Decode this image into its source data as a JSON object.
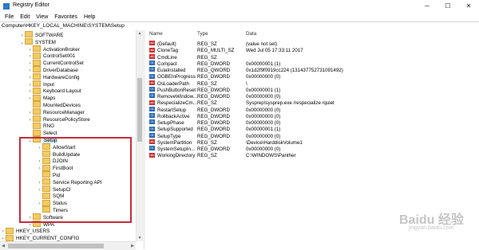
{
  "window": {
    "title": "Registry Editor",
    "min_label": "─",
    "max_label": "☐",
    "close_label": "✕"
  },
  "menu": [
    "File",
    "Edit",
    "View",
    "Favorites",
    "Help"
  ],
  "address": "Computer\\HKEY_LOCAL_MACHINE\\SYSTEM\\Setup",
  "tree": [
    {
      "label": "SOFTWARE",
      "level": 2,
      "expander": "›",
      "selected": false
    },
    {
      "label": "SYSTEM",
      "level": 2,
      "expander": "⌄",
      "selected": false
    },
    {
      "label": "ActivationBroker",
      "level": 3,
      "expander": "›",
      "selected": false
    },
    {
      "label": "ControlSet001",
      "level": 3,
      "expander": "›",
      "selected": false
    },
    {
      "label": "CurrentControlSet",
      "level": 3,
      "expander": "›",
      "selected": false
    },
    {
      "label": "DriverDatabase",
      "level": 3,
      "expander": "›",
      "selected": false
    },
    {
      "label": "HardwareConfig",
      "level": 3,
      "expander": "›",
      "selected": false
    },
    {
      "label": "Input",
      "level": 3,
      "expander": "›",
      "selected": false
    },
    {
      "label": "Keyboard Layout",
      "level": 3,
      "expander": "›",
      "selected": false
    },
    {
      "label": "Maps",
      "level": 3,
      "expander": "›",
      "selected": false
    },
    {
      "label": "MountedDevices",
      "level": 3,
      "expander": "",
      "selected": false
    },
    {
      "label": "ResourceManager",
      "level": 3,
      "expander": "›",
      "selected": false
    },
    {
      "label": "ResourcePolicyStore",
      "level": 3,
      "expander": "›",
      "selected": false
    },
    {
      "label": "RNG",
      "level": 3,
      "expander": "",
      "selected": false
    },
    {
      "label": "Select",
      "level": 3,
      "expander": "",
      "selected": false
    },
    {
      "label": "Setup",
      "level": 3,
      "expander": "⌄",
      "selected": true
    },
    {
      "label": "AllowStart",
      "level": 4,
      "expander": "›",
      "selected": false
    },
    {
      "label": "BuildUpdate",
      "level": 4,
      "expander": "",
      "selected": false
    },
    {
      "label": "DJOIN",
      "level": 4,
      "expander": "›",
      "selected": false
    },
    {
      "label": "FirstBoot",
      "level": 4,
      "expander": "›",
      "selected": false
    },
    {
      "label": "Pid",
      "level": 4,
      "expander": "",
      "selected": false
    },
    {
      "label": "Service Reporting API",
      "level": 4,
      "expander": "›",
      "selected": false
    },
    {
      "label": "SetupCl",
      "level": 4,
      "expander": "›",
      "selected": false
    },
    {
      "label": "SQM",
      "level": 4,
      "expander": "",
      "selected": false
    },
    {
      "label": "Status",
      "level": 4,
      "expander": "›",
      "selected": false
    },
    {
      "label": "Timers",
      "level": 4,
      "expander": "",
      "selected": false
    },
    {
      "label": "Software",
      "level": 3,
      "expander": "›",
      "selected": false
    },
    {
      "label": "WPA",
      "level": 3,
      "expander": "›",
      "selected": false
    },
    {
      "label": "HKEY_USERS",
      "level": 1,
      "expander": "›",
      "selected": false
    },
    {
      "label": "HKEY_CURRENT_CONFIG",
      "level": 1,
      "expander": "›",
      "selected": false
    }
  ],
  "columns": {
    "name": "Name",
    "type": "Type",
    "data": "Data"
  },
  "values": [
    {
      "icon": "sz",
      "name": "(Default)",
      "type": "REG_SZ",
      "data": "(value not set)"
    },
    {
      "icon": "sz",
      "name": "CloneTag",
      "type": "REG_MULTI_SZ",
      "data": "Wed Jul 05 17:33:11 2017"
    },
    {
      "icon": "sz",
      "name": "CmdLine",
      "type": "REG_SZ",
      "data": ""
    },
    {
      "icon": "bin",
      "name": "Compact",
      "type": "REG_DWORD",
      "data": "0x00000001 (1)"
    },
    {
      "icon": "bin",
      "name": "EulaInstalled",
      "type": "REG_QWORD",
      "data": "0x1d2f9f0919cc224 (131437752731091492)"
    },
    {
      "icon": "bin",
      "name": "OOBEInProgress",
      "type": "REG_DWORD",
      "data": "0x00000000 (0)"
    },
    {
      "icon": "sz",
      "name": "OsLoaderPath",
      "type": "REG_SZ",
      "data": "\\"
    },
    {
      "icon": "bin",
      "name": "PushButtonReset",
      "type": "REG_DWORD",
      "data": "0x00000001 (1)"
    },
    {
      "icon": "bin",
      "name": "RemoveWindow...",
      "type": "REG_DWORD",
      "data": "0x00000000 (0)"
    },
    {
      "icon": "sz",
      "name": "RespecializeCm...",
      "type": "REG_SZ",
      "data": "Sysprep\\sysprep.exe /respecialize /quiet"
    },
    {
      "icon": "bin",
      "name": "RestartSetup",
      "type": "REG_DWORD",
      "data": "0x00000000 (0)"
    },
    {
      "icon": "bin",
      "name": "RollbackActive",
      "type": "REG_DWORD",
      "data": "0x00000000 (0)"
    },
    {
      "icon": "bin",
      "name": "SetupPhase",
      "type": "REG_DWORD",
      "data": "0x00000000 (0)"
    },
    {
      "icon": "bin",
      "name": "SetupSupported",
      "type": "REG_DWORD",
      "data": "0x00000001 (1)"
    },
    {
      "icon": "bin",
      "name": "SetupType",
      "type": "REG_DWORD",
      "data": "0x00000000 (0)"
    },
    {
      "icon": "sz",
      "name": "SystemPartition",
      "type": "REG_SZ",
      "data": "\\Device\\HarddiskVolume1"
    },
    {
      "icon": "bin",
      "name": "SystemSetupIn...",
      "type": "REG_DWORD",
      "data": "0x00000000 (0)"
    },
    {
      "icon": "sz",
      "name": "WorkingDirectory",
      "type": "REG_SZ",
      "data": "C:\\WINDOWS\\Panther"
    }
  ],
  "icon_text": {
    "sz": "ab",
    "bin": "01"
  },
  "watermark": {
    "main": "Baidu 经验",
    "sub": "jingyan.baidu.com"
  },
  "accent": {
    "highlight_border": "#c32d3b",
    "selection": "#cce8ff",
    "folder": "#f2cb62"
  }
}
